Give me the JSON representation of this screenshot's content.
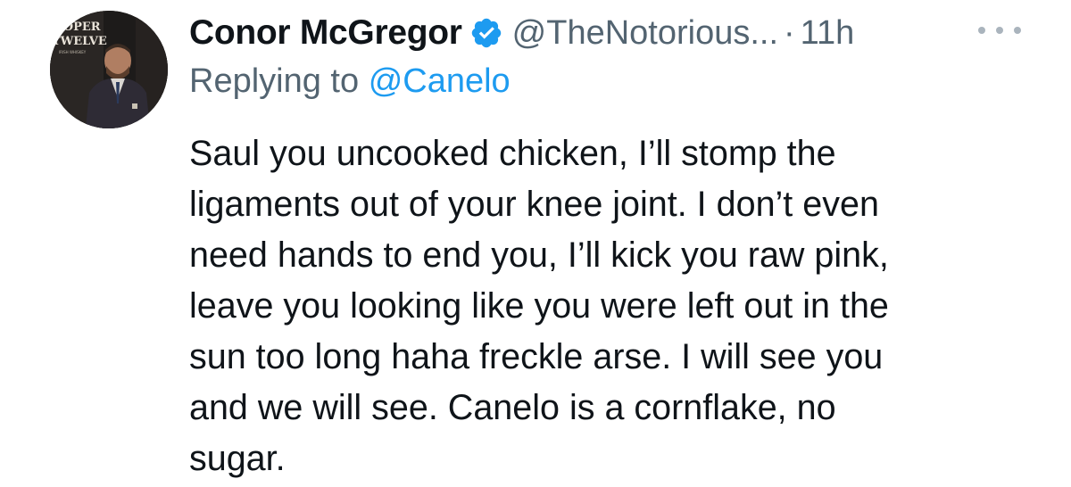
{
  "tweet": {
    "display_name": "Conor McGregor",
    "handle": "@TheNotorious...",
    "separator": "·",
    "time": "11h",
    "reply_prefix": "Replying to",
    "reply_to": "@Canelo",
    "avatar_text": {
      "line1": "ROPER",
      "line2": "TWELVE",
      "line3": "IRISH WHISKEY"
    },
    "text_lines": [
      "Saul you uncooked chicken, I’ll stomp the",
      "ligaments out of your knee joint. I don’t even",
      "need hands to end you, I’ll kick you raw pink,",
      "leave you looking like you were left out in the",
      "sun too long haha freckle arse. I will see you",
      "and we will see. Canelo is a cornflake, no",
      "sugar."
    ]
  },
  "colors": {
    "text_primary": "#0f1419",
    "text_secondary": "#536471",
    "link": "#1d9bf0",
    "verified_badge": "#1d9bf0"
  },
  "icons": {
    "verified": "verified-badge-icon",
    "more": "more-dots-icon"
  }
}
